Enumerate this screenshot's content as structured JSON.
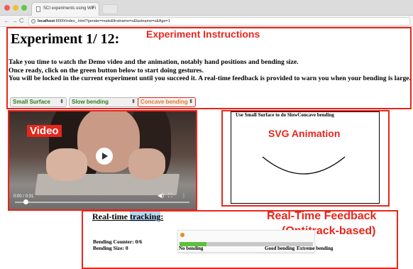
{
  "browser": {
    "tab_title": "SCI experiments using WiFi",
    "tab_close": "×",
    "nav_back": "←",
    "nav_forward": "→",
    "nav_reload": "C",
    "url_host": "localhost",
    "url_rest": ":8000/index_.html?gender=male&firstname=s&lastname=s&Age=1"
  },
  "page": {
    "title": "Experiment 1/ 12:",
    "instructions": [
      "Take you time to watch the Demo video and the animation, notably hand positions and bending size.",
      "Once ready, click on the green button below to start doing gestures.",
      "You will be locked in the current experiment until you succeed it. A real-time feedback is provided to warn you when your bending is large."
    ]
  },
  "selects": {
    "surface": "Small Surface",
    "speed": "Slow bending",
    "shape": "Concave bending",
    "caret": "⇕"
  },
  "video": {
    "time": "0:00 / 0:31",
    "volume_icon": "◀)",
    "fullscreen_icon": "⛶",
    "more_icon": "⋮"
  },
  "svg_animation": {
    "caption": "Use Small Surface to do SlowConcave bending"
  },
  "feedback": {
    "title_part1": "Real-time ",
    "title_part2": "tracking",
    "title_part3": ":",
    "counter": "Bending Counter: 0/6",
    "size": "Bending Size: 0",
    "meter_fill_fraction": 0.2,
    "labels": {
      "no": "No bending",
      "good": "Good bending",
      "extreme": "Extreme bending"
    }
  },
  "annotations": {
    "instructions": "Experiment Instructions",
    "video": "Video",
    "svg": "SVG Animation",
    "feedback_line1": "Real-Time Feedback",
    "feedback_line2": "(Optitrack-based)"
  },
  "colors": {
    "annotation_red": "#e8261c",
    "select_green": "#2e7d1e",
    "select_orange": "#e87b2a",
    "meter_green": "#5cc13c",
    "meter_dot": "#e88a2a"
  }
}
